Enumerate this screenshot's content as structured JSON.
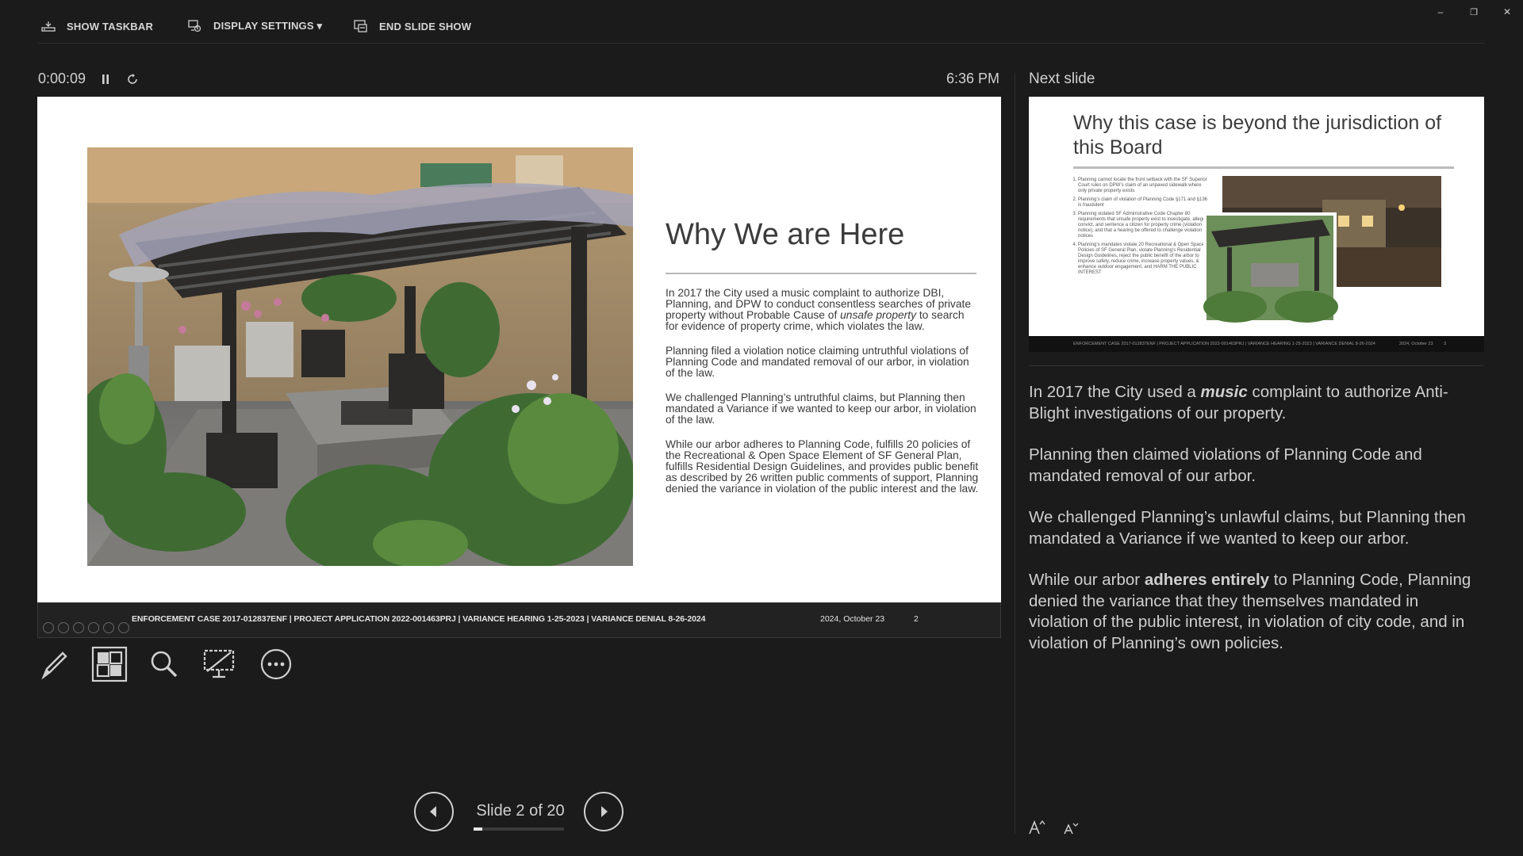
{
  "toolbar": {
    "show_taskbar": "SHOW TASKBAR",
    "display_settings": "DISPLAY SETTINGS ▾",
    "end_slide_show": "END SLIDE SHOW"
  },
  "timer": {
    "elapsed": "0:00:09",
    "clock": "6:36 PM"
  },
  "current_slide": {
    "title": "Why We are Here",
    "paragraphs": {
      "p1_a": "In 2017 the City used a music complaint to authorize DBI, Planning, and DPW to conduct consentless searches of private property without Probable Cause of ",
      "p1_em": "unsafe property",
      "p1_b": " to search for evidence of property crime, which violates the law.",
      "p2": "Planning filed a violation notice claiming untruthful violations of Planning Code and mandated removal of our arbor, in violation of the law.",
      "p3": "We challenged Planning’s untruthful claims, but Planning then mandated a Variance if we wanted to keep our arbor, in violation of the law.",
      "p4": "While our arbor adheres to Planning Code, fulfills 20 policies of the Recreational & Open Space Element of SF General Plan, fulfills Residential Design Guidelines, and provides public benefit as described by 26 written public comments of support, Planning denied the variance in violation of the public interest and the law."
    },
    "footer_text": "ENFORCEMENT CASE 2017-012837ENF | PROJECT APPLICATION 2022-001463PRJ | VARIANCE HEARING 1-25-2023 | VARIANCE DENIAL 8-26-2024",
    "footer_date": "2024, October 23",
    "footer_page": "2"
  },
  "navigation": {
    "slide_counter": "Slide 2 of 20",
    "progress": 0.1
  },
  "next_slide": {
    "label": "Next slide",
    "title": "Why this case is beyond the jurisdiction of this Board",
    "bullets": [
      "Planning cannot locate the front setback with the SF Superior Court rules on DPW’s claim of an unpaved sidewalk where only private property exists",
      "Planning’s claim of violation of Planning Code §171 and §136 is fraudulent",
      "Planning violated SF Administrative Code Chapter 80 requirements that unsafe property exist to investigate, allege, convict, and sentence a citizen for property crime (violation notice), and that a hearing be offered to challenge violation notices",
      "Planning’s mandates violate 20 Recreational & Open Space Policies of SF General Plan, violate Planning’s Residential Design Guidelines, reject the public benefit of the arbor to improve safety, reduce crime, increase property values, & enhance outdoor engagement, and HARM THE PUBLIC INTEREST"
    ],
    "footer_text": "ENFORCEMENT CASE 2017-012837ENF | PROJECT APPLICATION 2022-001463PRJ | VARIANCE HEARING 1-25-2023 | VARIANCE DENIAL 8-26-2024",
    "footer_date": "2024, October 23",
    "footer_page": "3"
  },
  "notes": {
    "n1_a": "In 2017 the City used a ",
    "n1_em": "music",
    "n1_b": " complaint to authorize Anti-Blight investigations of our property.",
    "n2": "Planning then claimed violations of Planning Code and mandated removal of our arbor.",
    "n3": "We challenged Planning’s unlawful claims, but Planning then mandated a Variance if we wanted to keep our arbor.",
    "n4_a": "While our arbor ",
    "n4_strong": "adheres entirely",
    "n4_b": " to Planning Code, Planning denied the variance that they themselves mandated in violation of the public interest, in violation of city code, and in violation of Planning’s own policies."
  },
  "icons": {
    "taskbar": "show-taskbar-icon",
    "display": "display-settings-icon",
    "end": "end-slideshow-icon",
    "pause": "pause-icon",
    "reset": "reset-timer-icon",
    "pen": "pen-tool-icon",
    "all_slides": "see-all-slides-icon",
    "zoom": "zoom-icon",
    "black_screen": "black-screen-icon",
    "more": "more-options-icon",
    "prev": "previous-slide-icon",
    "next": "next-slide-icon",
    "font_up": "increase-font-icon",
    "font_down": "decrease-font-icon"
  },
  "colors": {
    "background": "#1b1b1b",
    "text": "#d0d0d0",
    "slide_bg": "#ffffff",
    "slide_text": "#3a3a3a"
  },
  "window": {
    "minimize": "–",
    "restore": "❐",
    "close": "✕"
  }
}
